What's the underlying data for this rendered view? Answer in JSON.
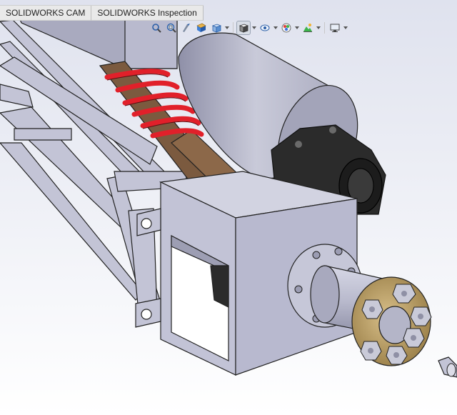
{
  "tabs": [
    {
      "label": "SOLIDWORKS CAM"
    },
    {
      "label": "SOLIDWORKS Inspection"
    }
  ],
  "toolbar": {
    "icons": [
      "zoom-to-fit-icon",
      "zoom-to-area-icon",
      "previous-view-icon",
      "section-view-icon",
      "view-orientation-icon",
      "display-style-icon",
      "hide-show-items-icon",
      "edit-appearance-icon",
      "apply-scene-icon",
      "view-settings-icon"
    ]
  },
  "colors": {
    "background_top": "#dfe2ee",
    "background_bottom": "#ffffff",
    "part_gray": "#b8b9cf",
    "spring_red": "#e1202a",
    "shock_brown": "#7b5a3f",
    "flange_gold": "#b79a60",
    "gearbox_black": "#2b2b2b"
  }
}
